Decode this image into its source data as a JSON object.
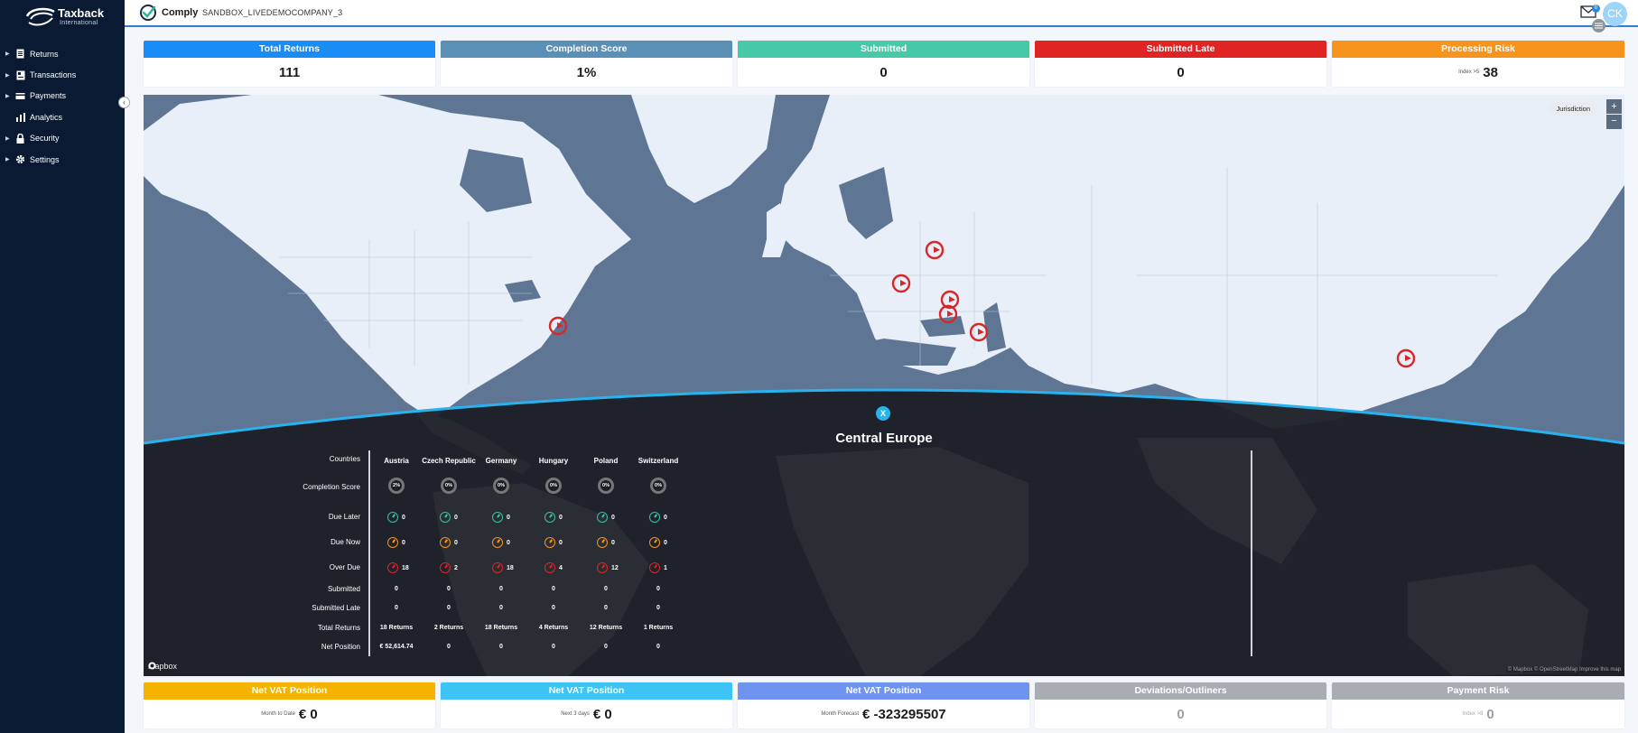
{
  "brand": {
    "name": "Taxback",
    "sub": "International"
  },
  "sidebar": {
    "items": [
      {
        "label": "Returns",
        "icon": "document-icon",
        "caret": true
      },
      {
        "label": "Transactions",
        "icon": "receipt-icon",
        "caret": true
      },
      {
        "label": "Payments",
        "icon": "payments-icon",
        "caret": true
      },
      {
        "label": "Analytics",
        "icon": "bar-chart-icon",
        "caret": false
      },
      {
        "label": "Security",
        "icon": "lock-icon",
        "caret": true
      },
      {
        "label": "Settings",
        "icon": "gear-icon",
        "caret": true
      }
    ]
  },
  "header": {
    "app_name": "Comply",
    "company": "SANDBOX_LIVEDEMOCOMPANY_3",
    "mail_count": "0",
    "avatar_initials": "CK"
  },
  "kpis": {
    "total_returns": {
      "title": "Total Returns",
      "value": "111",
      "color": "#1a8cf6"
    },
    "completion": {
      "title": "Completion Score",
      "value": "1%",
      "color": "#5a8fb6"
    },
    "submitted": {
      "title": "Submitted",
      "value": "0",
      "color": "#47c9a8"
    },
    "submitted_late": {
      "title": "Submitted Late",
      "value": "0",
      "color": "#e02424"
    },
    "processing_risk": {
      "title": "Processing Risk",
      "sub": "Index >5",
      "value": "38",
      "color": "#f7941d"
    }
  },
  "map": {
    "jurisdiction_label": "Jurisdiction",
    "zoom_in": "+",
    "zoom_out": "−",
    "mapbox_label": "mapbox",
    "attribution": "© Mapbox © OpenStreetMap Improve this map",
    "colors": {
      "ocean": "#5e7693",
      "land": "#e8eff8",
      "marker": "#d62828",
      "panel": "#1b1e24",
      "arc": "#27b4ee"
    },
    "region": {
      "title": "Central Europe",
      "close": "X",
      "row_labels": [
        "Countries",
        "Completion Score",
        "Due Later",
        "Due Now",
        "Over Due",
        "Submitted",
        "Submitted Late",
        "Total Returns",
        "Net Position"
      ],
      "countries": [
        {
          "name": "Austria",
          "score": "2%",
          "due_later": "0",
          "due_now": "0",
          "over_due": "18",
          "submitted": "0",
          "submitted_late": "0",
          "total": "18 Returns",
          "net": "€ 52,614.74"
        },
        {
          "name": "Czech Republic",
          "score": "0%",
          "due_later": "0",
          "due_now": "0",
          "over_due": "2",
          "submitted": "0",
          "submitted_late": "0",
          "total": "2 Returns",
          "net": "0"
        },
        {
          "name": "Germany",
          "score": "0%",
          "due_later": "0",
          "due_now": "0",
          "over_due": "18",
          "submitted": "0",
          "submitted_late": "0",
          "total": "18 Returns",
          "net": "0"
        },
        {
          "name": "Hungary",
          "score": "0%",
          "due_later": "0",
          "due_now": "0",
          "over_due": "4",
          "submitted": "0",
          "submitted_late": "0",
          "total": "4 Returns",
          "net": "0"
        },
        {
          "name": "Poland",
          "score": "0%",
          "due_later": "0",
          "due_now": "0",
          "over_due": "12",
          "submitted": "0",
          "submitted_late": "0",
          "total": "12 Returns",
          "net": "0"
        },
        {
          "name": "Switzerland",
          "score": "0%",
          "due_later": "0",
          "due_now": "0",
          "over_due": "1",
          "submitted": "0",
          "submitted_late": "0",
          "total": "1 Returns",
          "net": "0"
        }
      ]
    }
  },
  "bottom": {
    "mtd": {
      "title": "Net VAT Position",
      "sub": "Month to Date",
      "value": "€ 0",
      "color": "#f5b300"
    },
    "next3": {
      "title": "Net VAT Position",
      "sub": "Next 3 days",
      "value": "€ 0",
      "color": "#3ec4f4"
    },
    "forecast": {
      "title": "Net VAT Position",
      "sub": "Month Forecast",
      "value": "€ -323295507",
      "color": "#6f94ef"
    },
    "deviations": {
      "title": "Deviations/Outliners",
      "value": "0",
      "color": "#a8adb3"
    },
    "payment_risk": {
      "title": "Payment Risk",
      "sub": "Index >8",
      "value": "0",
      "color": "#a8adb3"
    }
  }
}
